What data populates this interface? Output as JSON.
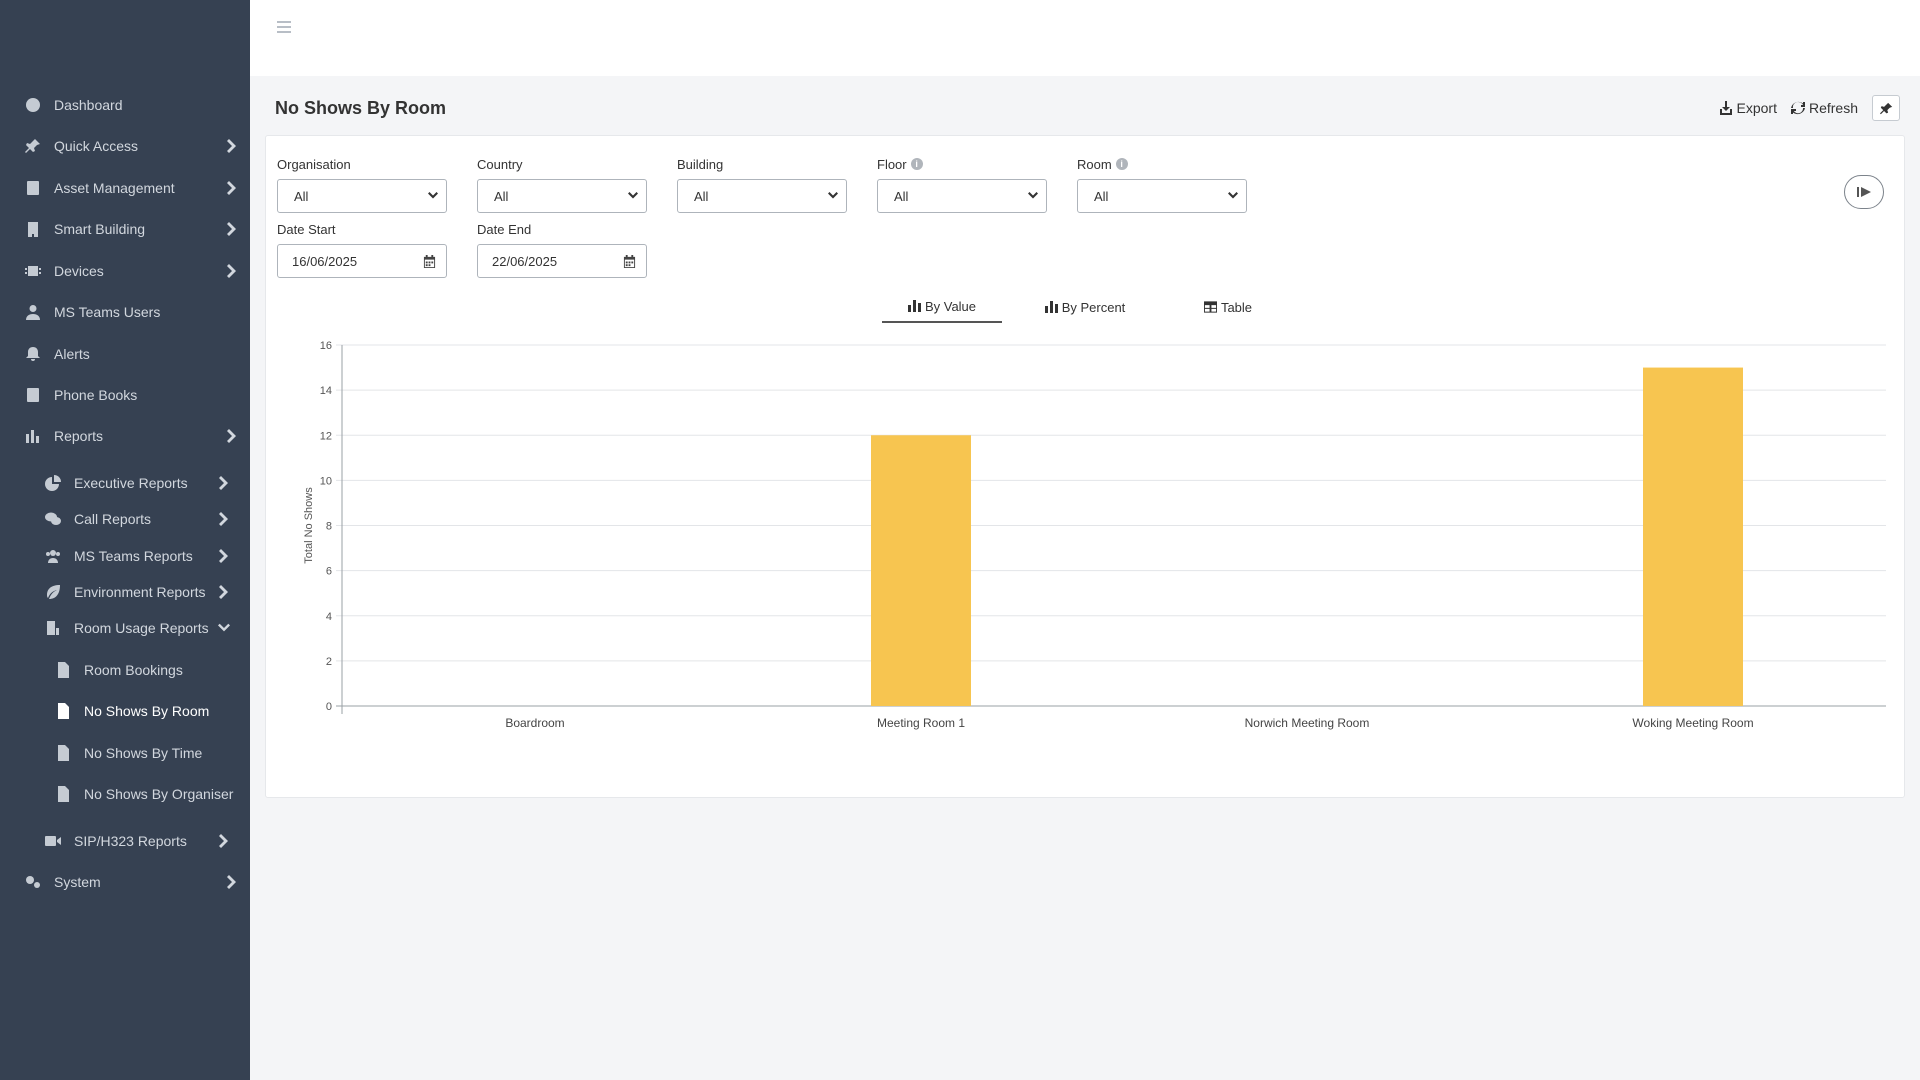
{
  "sidebar": {
    "items": [
      {
        "label": "Dashboard",
        "icon": "dashboard-icon"
      },
      {
        "label": "Quick Access",
        "icon": "pin-icon"
      },
      {
        "label": "Asset Management",
        "icon": "book-icon"
      },
      {
        "label": "Smart Building",
        "icon": "building-icon"
      },
      {
        "label": "Devices",
        "icon": "chip-icon"
      },
      {
        "label": "MS Teams Users",
        "icon": "user-icon"
      },
      {
        "label": "Alerts",
        "icon": "bell-icon"
      },
      {
        "label": "Phone Books",
        "icon": "address-book-icon"
      },
      {
        "label": "Reports",
        "icon": "bar-chart-icon"
      },
      {
        "label": "Executive Reports",
        "icon": "pie-chart-icon"
      },
      {
        "label": "Call Reports",
        "icon": "comments-icon"
      },
      {
        "label": "MS Teams Reports",
        "icon": "users-icon"
      },
      {
        "label": "Environment Reports",
        "icon": "leaf-icon"
      },
      {
        "label": "Room Usage Reports",
        "icon": "room-icon"
      },
      {
        "label": "Room Bookings",
        "icon": "document-icon"
      },
      {
        "label": "No Shows By Room",
        "icon": "document-icon"
      },
      {
        "label": "No Shows By Time",
        "icon": "document-icon"
      },
      {
        "label": "No Shows By Organiser",
        "icon": "document-icon"
      },
      {
        "label": "SIP/H323 Reports",
        "icon": "video-icon"
      },
      {
        "label": "System",
        "icon": "gears-icon"
      }
    ]
  },
  "page": {
    "title": "No Shows By Room",
    "export_label": "Export",
    "refresh_label": "Refresh"
  },
  "filters": {
    "organisation": {
      "label": "Organisation",
      "value": "All"
    },
    "country": {
      "label": "Country",
      "value": "All"
    },
    "building": {
      "label": "Building",
      "value": "All"
    },
    "floor": {
      "label": "Floor",
      "value": "All"
    },
    "room": {
      "label": "Room",
      "value": "All"
    },
    "date_start": {
      "label": "Date Start",
      "value": "16/06/2025"
    },
    "date_end": {
      "label": "Date End",
      "value": "22/06/2025"
    }
  },
  "tabs": [
    {
      "label": "By Value",
      "active": true
    },
    {
      "label": "By Percent",
      "active": false
    },
    {
      "label": "Table",
      "active": false
    }
  ],
  "colors": {
    "sidebar_bg": "#364152",
    "bar": "#f7c550"
  },
  "chart_data": {
    "type": "bar",
    "categories": [
      "Boardroom",
      "Meeting Room 1",
      "Norwich Meeting Room",
      "Woking Meeting Room"
    ],
    "values": [
      0,
      12,
      0,
      15
    ],
    "title": "",
    "xlabel": "",
    "ylabel": "Total No Shows",
    "ylim": [
      0,
      16
    ],
    "yticks": [
      0,
      2,
      4,
      6,
      8,
      10,
      12,
      14,
      16
    ],
    "grid": true
  }
}
